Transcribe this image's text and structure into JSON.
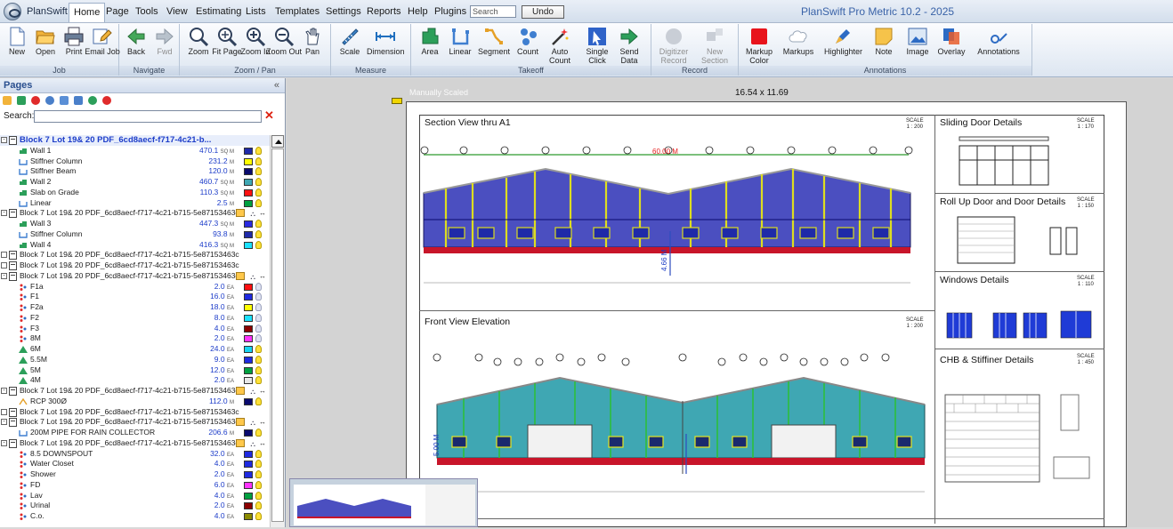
{
  "menubar": {
    "brand": "PlanSwift",
    "items": [
      "Home",
      "Page",
      "Tools",
      "View",
      "Estimating",
      "Lists",
      "Templates",
      "Settings",
      "Reports",
      "Help",
      "Plugins"
    ],
    "search_placeholder": "Search",
    "undo_label": "Undo",
    "window_title": "PlanSwift Pro Metric 10.2 - 2025"
  },
  "ribbon": {
    "job": {
      "label": "Job",
      "buttons": [
        "New",
        "Open",
        "Print",
        "Email Job"
      ]
    },
    "navigate": {
      "label": "Navigate",
      "buttons": [
        "Back",
        "Fwd"
      ]
    },
    "zoom": {
      "label": "Zoom / Pan",
      "buttons": [
        "Zoom",
        "Fit Page",
        "Zoom In",
        "Zoom Out",
        "Pan"
      ]
    },
    "measure": {
      "label": "Measure",
      "buttons": [
        "Scale",
        "Dimension"
      ]
    },
    "takeoff": {
      "label": "Takeoff",
      "buttons": [
        "Area",
        "Linear",
        "Segment",
        "Count",
        "Auto Count",
        "Single Click",
        "Send Data"
      ]
    },
    "record": {
      "label": "Record",
      "buttons": [
        "Digitizer Record",
        "New Section"
      ]
    },
    "annotations": {
      "label": "Annotations",
      "buttons": [
        "Markup Color",
        "Markups",
        "Highlighter",
        "Note",
        "Image",
        "Overlay",
        "Annotations"
      ]
    }
  },
  "pages_panel": {
    "title": "Pages",
    "collapse": "«",
    "search_label": "Search:",
    "clear": "✕",
    "rows": [
      {
        "kind": "page",
        "name": "Block 7 Lot 19& 20 PDF_6cd8aecf-f717-4c21-b...",
        "selected": true,
        "exp": "-"
      },
      {
        "kind": "item",
        "icon": "area",
        "name": "Wall 1",
        "qty": "470.1",
        "unit": "SQ M",
        "color": "#1f2aa8",
        "bulb": true
      },
      {
        "kind": "item",
        "icon": "linear",
        "name": "Stiffner Column",
        "qty": "231.2",
        "unit": "M",
        "color": "#ffff00",
        "bulb": true
      },
      {
        "kind": "item",
        "icon": "linear",
        "name": "Stiffner Beam",
        "qty": "120.0",
        "unit": "M",
        "color": "#0a0a6e",
        "bulb": true
      },
      {
        "kind": "item",
        "icon": "area",
        "name": "Wall 2",
        "qty": "460.7",
        "unit": "SQ M",
        "color": "#3fa7b3",
        "bulb": true
      },
      {
        "kind": "item",
        "icon": "area",
        "name": "Slab on Grade",
        "qty": "110.3",
        "unit": "SQ M",
        "color": "#ff1010",
        "bulb": true
      },
      {
        "kind": "item",
        "icon": "linear",
        "name": "Linear",
        "qty": "2.5",
        "unit": "M",
        "color": "#00a040",
        "bulb": true
      },
      {
        "kind": "page",
        "name": "Block 7 Lot 19& 20 PDF_6cd8aecf-f717-4c21-b715-5e87153463c",
        "exp": "-",
        "icons": true
      },
      {
        "kind": "item",
        "icon": "area",
        "name": "Wall 3",
        "qty": "447.3",
        "unit": "SQ M",
        "color": "#2a2ae0",
        "bulb": true
      },
      {
        "kind": "item",
        "icon": "linear",
        "name": "Stiffner Column",
        "qty": "93.8",
        "unit": "M",
        "color": "#1f2aa8",
        "bulb": true
      },
      {
        "kind": "item",
        "icon": "area",
        "name": "Wall 4",
        "qty": "416.3",
        "unit": "SQ M",
        "color": "#1be1ff",
        "bulb": true
      },
      {
        "kind": "page",
        "name": "Block 7 Lot 19& 20 PDF_6cd8aecf-f717-4c21-b715-5e87153463c",
        "exp": ""
      },
      {
        "kind": "page",
        "name": "Block 7 Lot 19& 20 PDF_6cd8aecf-f717-4c21-b715-5e87153463c",
        "exp": ""
      },
      {
        "kind": "page",
        "name": "Block 7 Lot 19& 20 PDF_6cd8aecf-f717-4c21-b715-5e87153463c",
        "exp": "-",
        "icons": true
      },
      {
        "kind": "item",
        "icon": "count",
        "name": "F1a",
        "qty": "2.0",
        "unit": "EA",
        "color": "#ff1010",
        "bulb": false
      },
      {
        "kind": "item",
        "icon": "count",
        "name": "F1",
        "qty": "16.0",
        "unit": "EA",
        "color": "#1f2ae0",
        "bulb": false
      },
      {
        "kind": "item",
        "icon": "count",
        "name": "F2a",
        "qty": "18.0",
        "unit": "EA",
        "color": "#ffff00",
        "bulb": false
      },
      {
        "kind": "item",
        "icon": "count",
        "name": "F2",
        "qty": "8.0",
        "unit": "EA",
        "color": "#1be1ff",
        "bulb": false
      },
      {
        "kind": "item",
        "icon": "count",
        "name": "F3",
        "qty": "4.0",
        "unit": "EA",
        "color": "#8b0000",
        "bulb": false
      },
      {
        "kind": "item",
        "icon": "count",
        "name": "8M",
        "qty": "2.0",
        "unit": "EA",
        "color": "#ff33ff",
        "bulb": false
      },
      {
        "kind": "item",
        "icon": "tri",
        "name": "6M",
        "qty": "24.0",
        "unit": "EA",
        "color": "#17d4f0",
        "bulb": true
      },
      {
        "kind": "item",
        "icon": "tri",
        "name": "5.5M",
        "qty": "9.0",
        "unit": "EA",
        "color": "#1f2ae0",
        "bulb": true
      },
      {
        "kind": "item",
        "icon": "tri",
        "name": "5M",
        "qty": "12.0",
        "unit": "EA",
        "color": "#00a040",
        "bulb": true
      },
      {
        "kind": "item",
        "icon": "tri",
        "name": "4M",
        "qty": "2.0",
        "unit": "EA",
        "color": "#e7e7e7",
        "bulb": true
      },
      {
        "kind": "page",
        "name": "Block 7 Lot 19& 20 PDF_6cd8aecf-f717-4c21-b715-5e87153463c",
        "exp": "-",
        "icons": true
      },
      {
        "kind": "item",
        "icon": "count-orange",
        "name": "RCP 300Ø",
        "qty": "112.0",
        "unit": "M",
        "color": "#0a0a6e",
        "bulb": true
      },
      {
        "kind": "page",
        "name": "Block 7 Lot 19& 20 PDF_6cd8aecf-f717-4c21-b715-5e87153463c",
        "exp": ""
      },
      {
        "kind": "page",
        "name": "Block 7 Lot 19& 20 PDF_6cd8aecf-f717-4c21-b715-5e87153463c",
        "exp": "-",
        "icons": true
      },
      {
        "kind": "item",
        "icon": "linear",
        "name": "200M PIPE FOR RAIN COLLECTOR",
        "qty": "206.6",
        "unit": "M",
        "color": "#0a0a6e",
        "bulb": true
      },
      {
        "kind": "page",
        "name": "Block 7 Lot 19& 20 PDF_6cd8aecf-f717-4c21-b715-5e87153463c",
        "exp": "-",
        "icons": true
      },
      {
        "kind": "item",
        "icon": "count",
        "name": "8.5 DOWNSPOUT",
        "qty": "32.0",
        "unit": "EA",
        "color": "#1f2ae0",
        "bulb": true
      },
      {
        "kind": "item",
        "icon": "count",
        "name": "Water Closet",
        "qty": "4.0",
        "unit": "EA",
        "color": "#1f2ae0",
        "bulb": true
      },
      {
        "kind": "item",
        "icon": "count",
        "name": "Shower",
        "qty": "2.0",
        "unit": "EA",
        "color": "#1f2ae0",
        "bulb": true
      },
      {
        "kind": "item",
        "icon": "count",
        "name": "FD",
        "qty": "6.0",
        "unit": "EA",
        "color": "#ff33ff",
        "bulb": true
      },
      {
        "kind": "item",
        "icon": "count",
        "name": "Lav",
        "qty": "4.0",
        "unit": "EA",
        "color": "#00a040",
        "bulb": true
      },
      {
        "kind": "item",
        "icon": "count",
        "name": "Urinal",
        "qty": "2.0",
        "unit": "EA",
        "color": "#8b0000",
        "bulb": true
      },
      {
        "kind": "item",
        "icon": "count",
        "name": "C.o.",
        "qty": "4.0",
        "unit": "EA",
        "color": "#8b8b00",
        "bulb": true
      }
    ]
  },
  "canvas": {
    "manually_scaled": "Manually Scaled",
    "sheet_size": "16.54 x 11.69",
    "views": {
      "section": {
        "title": "Section View thru A1",
        "scale": "SCALE\n1 : 200",
        "dim": "60.00 M",
        "height": "4.66 M"
      },
      "front": {
        "title": "Front View Elevation",
        "scale": "SCALE\n1 : 200",
        "height": "5.00 M"
      },
      "sliding": {
        "title": "Sliding Door Details",
        "scale": "SCALE\n1 : 170"
      },
      "rollup": {
        "title": "Roll Up Door and Door Details",
        "scale": "SCALE\n1 : 150"
      },
      "windows": {
        "title": "Windows Details",
        "scale": "SCALE\n1 : 110"
      },
      "chb": {
        "title": "CHB & Stiffiner Details",
        "scale": "SCALE\n1 : 450"
      }
    },
    "colors": {
      "wall_blue": "#4b4fc0",
      "wall_teal": "#3fa7b3",
      "slab_red": "#c8152a",
      "stiffener": "#dddd20"
    }
  }
}
